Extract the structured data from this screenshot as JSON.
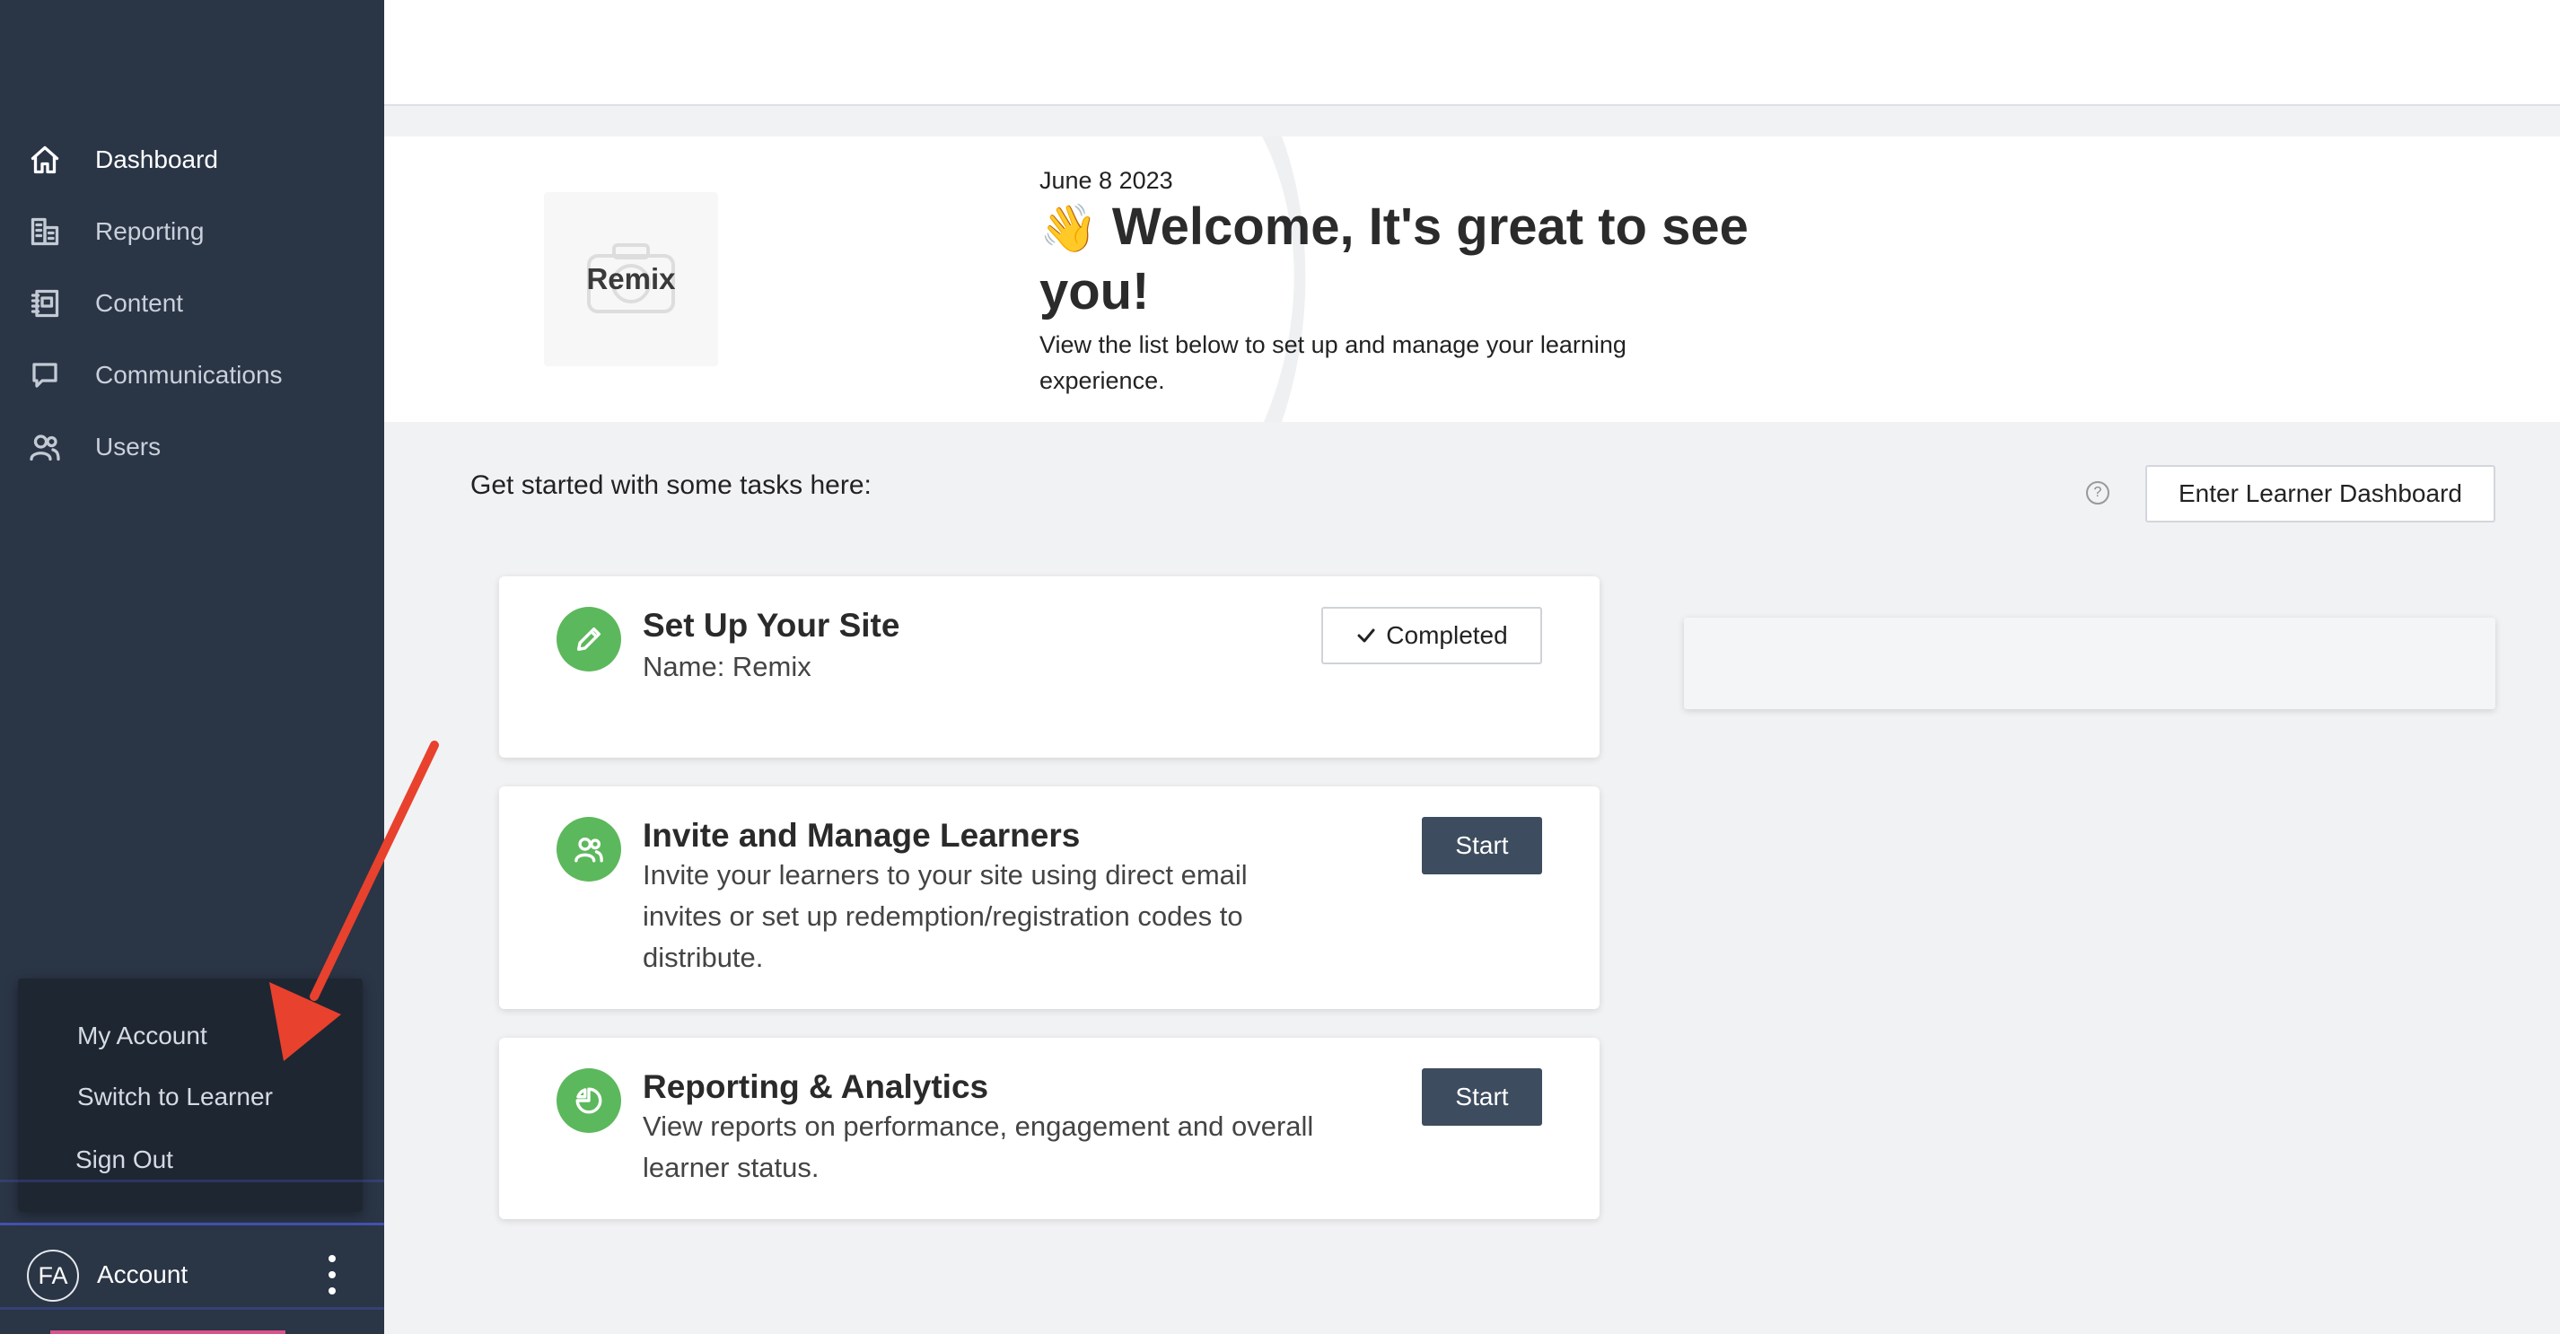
{
  "sidebar": {
    "nav": [
      {
        "label": "Dashboard",
        "icon": "home-icon",
        "active": true
      },
      {
        "label": "Reporting",
        "icon": "buildings-icon",
        "active": false
      },
      {
        "label": "Content",
        "icon": "content-icon",
        "active": false
      },
      {
        "label": "Communications",
        "icon": "chat-icon",
        "active": false
      },
      {
        "label": "Users",
        "icon": "users-icon",
        "active": false
      }
    ],
    "account_menu": [
      "My Account",
      "Switch to Learner",
      "Sign Out"
    ],
    "account": {
      "initials": "FA",
      "label": "Account"
    }
  },
  "banner": {
    "logo_text": "Remix",
    "date": "June 8 2023",
    "wave_emoji": "👋",
    "welcome": "Welcome, It's great to see you!",
    "subtext": "View the list below to set up and manage your learning experience."
  },
  "tasks": {
    "heading": "Get started with some tasks here:",
    "help": "?",
    "enter_button": "Enter Learner Dashboard",
    "cards": [
      {
        "title": "Set Up Your Site",
        "desc": "Name: Remix",
        "button": "Completed",
        "status": "completed",
        "icon": "pencil-icon"
      },
      {
        "title": "Invite and Manage Learners",
        "desc": "Invite your learners to your site using direct email invites or set up redemption/registration codes to distribute.",
        "button": "Start",
        "status": "todo",
        "icon": "users-icon"
      },
      {
        "title": "Reporting & Analytics",
        "desc": "View reports on performance, engagement and overall learner status.",
        "button": "Start",
        "status": "todo",
        "icon": "pie-chart-icon"
      }
    ]
  },
  "colors": {
    "sidebar_bg": "#2a3546",
    "task_icon_green": "#5cb85c",
    "start_button": "#3d4c5e",
    "annotation_arrow": "#e8412e"
  }
}
